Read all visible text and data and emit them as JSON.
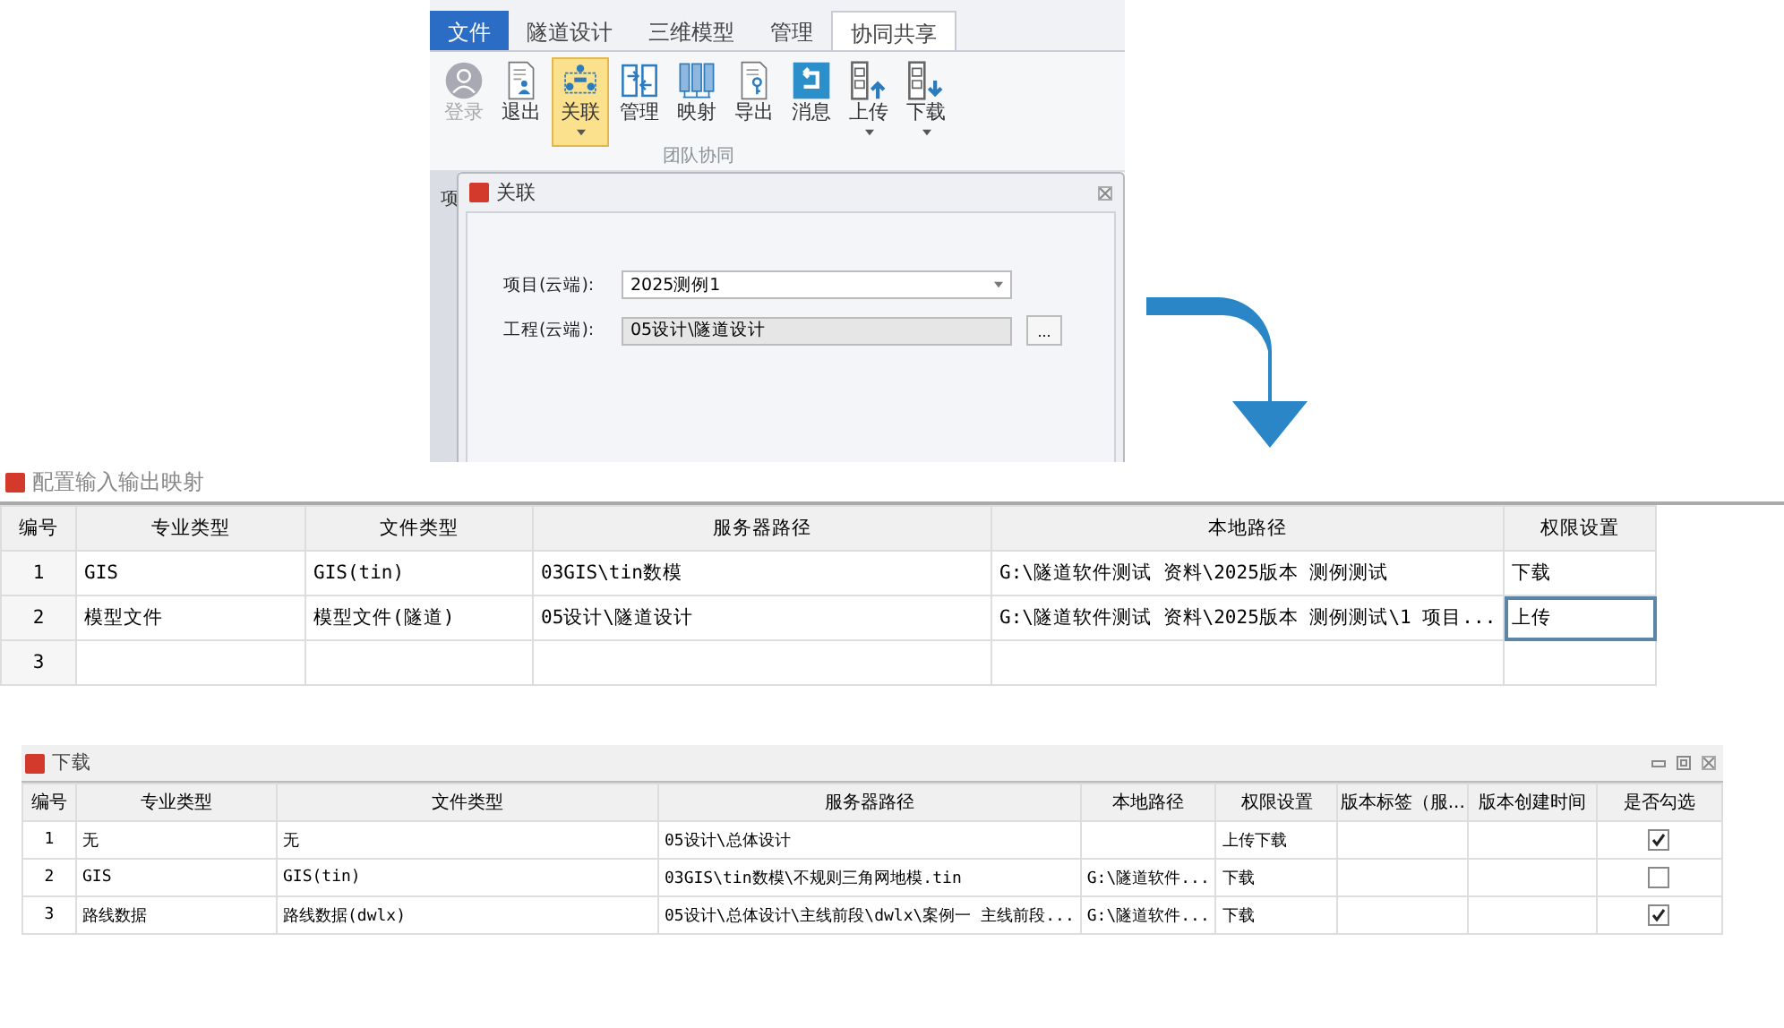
{
  "ribbon": {
    "tabs": [
      {
        "label": "文件",
        "kind": "file",
        "selected": false
      },
      {
        "label": "隧道设计",
        "kind": "tab",
        "selected": false
      },
      {
        "label": "三维模型",
        "kind": "tab",
        "selected": false
      },
      {
        "label": "管理",
        "kind": "tab",
        "selected": false
      },
      {
        "label": "协同共享",
        "kind": "tab",
        "selected": true
      }
    ],
    "buttons": [
      {
        "label": "登录",
        "kind": "user",
        "disabled": true,
        "selected": false,
        "dropdown": false
      },
      {
        "label": "退出",
        "kind": "doc",
        "disabled": false,
        "selected": false,
        "dropdown": false
      },
      {
        "label": "关联",
        "kind": "link",
        "disabled": false,
        "selected": true,
        "dropdown": true
      },
      {
        "label": "管理",
        "kind": "manage",
        "disabled": false,
        "selected": false,
        "dropdown": false
      },
      {
        "label": "映射",
        "kind": "map",
        "disabled": false,
        "selected": false,
        "dropdown": false
      },
      {
        "label": "导出",
        "kind": "export",
        "disabled": false,
        "selected": false,
        "dropdown": false
      },
      {
        "label": "消息",
        "kind": "message",
        "disabled": false,
        "selected": false,
        "dropdown": false
      },
      {
        "label": "上传",
        "kind": "upload",
        "disabled": false,
        "selected": false,
        "dropdown": true
      },
      {
        "label": "下载",
        "kind": "download",
        "disabled": false,
        "selected": false,
        "dropdown": true
      }
    ],
    "group_label": "团队协同",
    "side_label": "项"
  },
  "dialog": {
    "title": "关联",
    "fields": [
      {
        "label": "项目(云端):",
        "value": "2025测例1",
        "kind": "dropdown"
      },
      {
        "label": "工程(云端):",
        "value": "05设计\\隧道设计",
        "kind": "readonly",
        "button": "..."
      }
    ]
  },
  "mapping": {
    "title": "配置输入输出映射",
    "columns": [
      "编号",
      "专业类型",
      "文件类型",
      "服务器路径",
      "本地路径",
      "权限设置"
    ],
    "rows": [
      {
        "cells": [
          "1",
          "GIS",
          "GIS(tin)",
          "03GIS\\tin数模",
          "G:\\隧道软件测试 资料\\2025版本 测例测试",
          "下载"
        ],
        "selected": false
      },
      {
        "cells": [
          "2",
          "模型文件",
          "模型文件(隧道)",
          "05设计\\隧道设计",
          "G:\\隧道软件测试 资料\\2025版本 测例测试\\1 项目...",
          "上传"
        ],
        "selected": true
      },
      {
        "cells": [
          "3",
          "",
          "",
          "",
          "",
          ""
        ],
        "selected": false
      }
    ]
  },
  "download": {
    "title": "下载",
    "columns": [
      "编号",
      "专业类型",
      "文件类型",
      "服务器路径",
      "本地路径",
      "权限设置",
      "版本标签（服...",
      "版本创建时间",
      "是否勾选"
    ],
    "rows": [
      {
        "cells": [
          "1",
          "无",
          "无",
          "05设计\\总体设计",
          "",
          "上传下载",
          "",
          ""
        ],
        "checked": true
      },
      {
        "cells": [
          "2",
          "GIS",
          "GIS(tin)",
          "03GIS\\tin数模\\不规则三角网地模.tin",
          "G:\\隧道软件...",
          "下载",
          "",
          ""
        ],
        "checked": false
      },
      {
        "cells": [
          "3",
          "路线数据",
          "路线数据(dwlx)",
          "05设计\\总体设计\\主线前段\\dwlx\\案例一 主线前段...",
          "G:\\隧道软件...",
          "下载",
          "",
          ""
        ],
        "checked": true
      }
    ]
  }
}
